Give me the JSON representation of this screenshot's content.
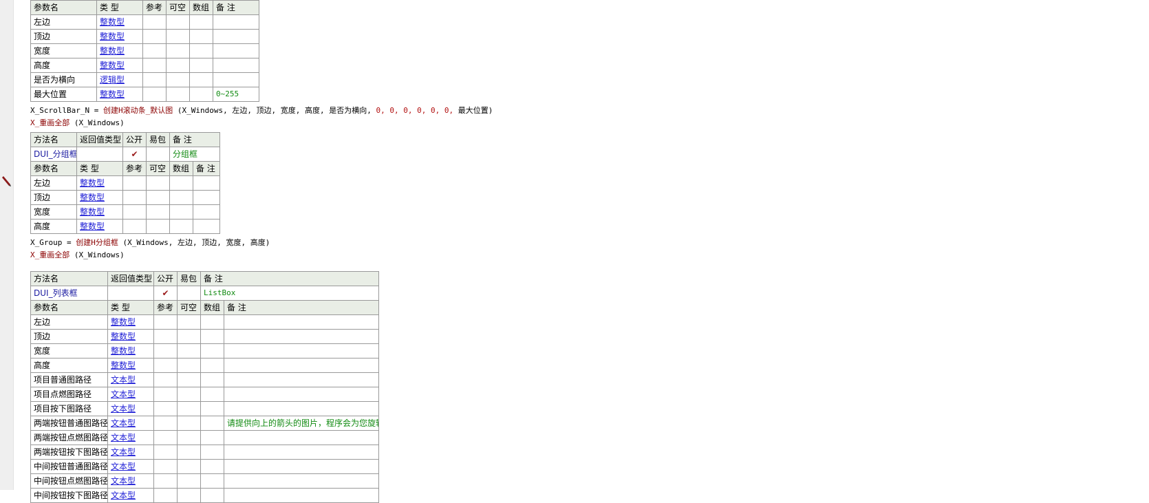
{
  "table1": {
    "headers": [
      "参数名",
      "类 型",
      "参考",
      "可空",
      "数组",
      "备 注"
    ],
    "rows": [
      {
        "name": "左边",
        "type": "整数型",
        "note": ""
      },
      {
        "name": "顶边",
        "type": "整数型",
        "note": ""
      },
      {
        "name": "宽度",
        "type": "整数型",
        "note": ""
      },
      {
        "name": "高度",
        "type": "整数型",
        "note": ""
      },
      {
        "name": "是否为横向",
        "type": "逻辑型",
        "note": ""
      },
      {
        "name": "最大位置",
        "type": "整数型",
        "note": "0~255"
      }
    ]
  },
  "code1": {
    "var": "X_ScrollBar_N",
    "op": "=",
    "func": "创建H滚动条_默认图",
    "open": "(",
    "args_plain": "X_Windows, 左边, 顶边, 宽度, 高度, 是否为横向,",
    "args_red": "0, 0, 0, 0, 0, 0,",
    "args_tail": "最大位置)"
  },
  "code2": {
    "func": "X_重画全部",
    "args": "(X_Windows)"
  },
  "table2": {
    "method_headers": [
      "方法名",
      "返回值类型",
      "公开",
      "易包",
      "备 注"
    ],
    "method": {
      "name": "DUI_分组框",
      "ret": "",
      "public_mark": "✔",
      "note": "分组框"
    },
    "param_headers": [
      "参数名",
      "类 型",
      "参考",
      "可空",
      "数组",
      "备 注"
    ],
    "rows": [
      {
        "name": "左边",
        "type": "整数型"
      },
      {
        "name": "顶边",
        "type": "整数型"
      },
      {
        "name": "宽度",
        "type": "整数型"
      },
      {
        "name": "高度",
        "type": "整数型"
      }
    ]
  },
  "code3": {
    "var": "X_Group",
    "op": "=",
    "func": "创建H分组框",
    "args": "(X_Windows, 左边, 顶边, 宽度, 高度)"
  },
  "code4": {
    "func": "X_重画全部",
    "args": "(X_Windows)"
  },
  "table3": {
    "method_headers": [
      "方法名",
      "返回值类型",
      "公开",
      "易包",
      "备 注"
    ],
    "method": {
      "name": "DUI_列表框",
      "ret": "",
      "public_mark": "✔",
      "note": "ListBox"
    },
    "param_headers": [
      "参数名",
      "类 型",
      "参考",
      "可空",
      "数组",
      "备 注"
    ],
    "rows": [
      {
        "name": "左边",
        "type": "整数型",
        "note": ""
      },
      {
        "name": "顶边",
        "type": "整数型",
        "note": ""
      },
      {
        "name": "宽度",
        "type": "整数型",
        "note": ""
      },
      {
        "name": "高度",
        "type": "整数型",
        "note": ""
      },
      {
        "name": "项目普通图路径",
        "type": "文本型",
        "note": ""
      },
      {
        "name": "项目点燃图路径",
        "type": "文本型",
        "note": ""
      },
      {
        "name": "项目按下图路径",
        "type": "文本型",
        "note": ""
      },
      {
        "name": "两端按钮普通图路径",
        "type": "文本型",
        "note": "请提供向上的箭头的图片，程序会为您旋转"
      },
      {
        "name": "两端按钮点燃图路径",
        "type": "文本型",
        "note": ""
      },
      {
        "name": "两端按钮按下图路径",
        "type": "文本型",
        "note": ""
      },
      {
        "name": "中间按钮普通图路径",
        "type": "文本型",
        "note": ""
      },
      {
        "name": "中间按钮点燃图路径",
        "type": "文本型",
        "note": ""
      },
      {
        "name": "中间按钮按下图路径",
        "type": "文本型",
        "note": ""
      }
    ]
  }
}
